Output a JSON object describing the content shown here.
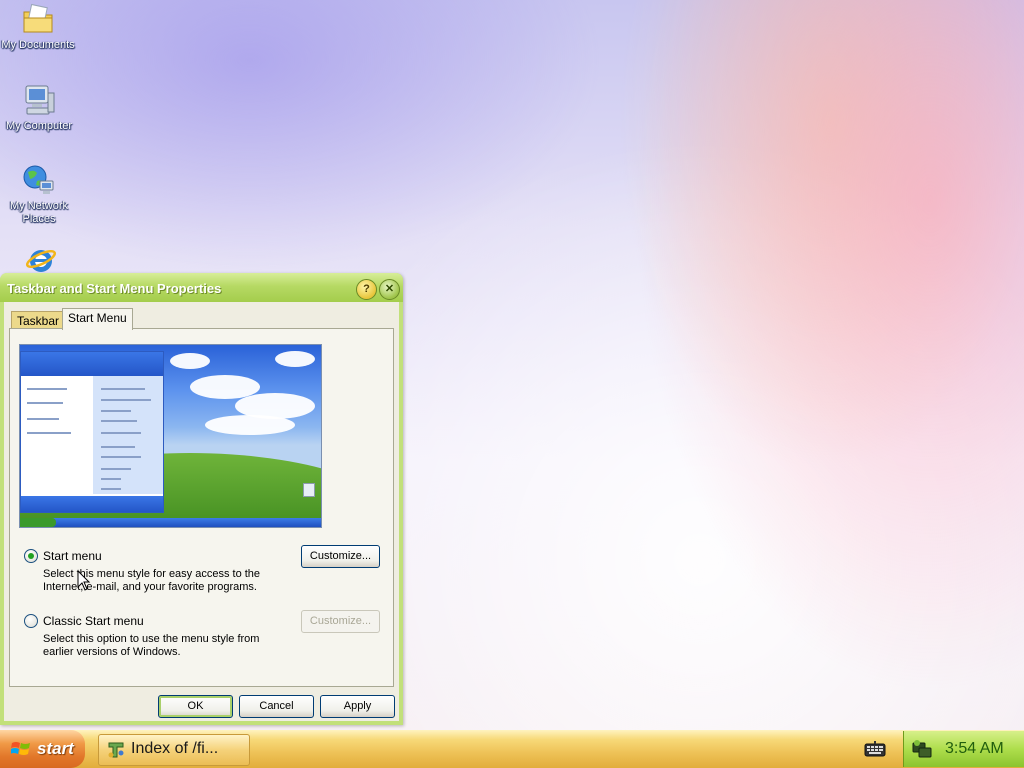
{
  "desktop": {
    "icons": [
      {
        "label": "My Documents",
        "icon": "folder-documents-icon"
      },
      {
        "label": "My Computer",
        "icon": "computer-icon"
      },
      {
        "label": "My Network Places",
        "icon": "network-icon"
      },
      {
        "label": "",
        "icon": "internet-explorer-icon"
      }
    ]
  },
  "dialog": {
    "title": "Taskbar and Start Menu Properties",
    "help_glyph": "?",
    "close_glyph": "✕",
    "tabs": [
      {
        "label": "Taskbar",
        "selected": false
      },
      {
        "label": "Start Menu",
        "selected": true
      }
    ],
    "options": {
      "start_menu": {
        "label": "Start menu",
        "selected": true,
        "description_line1": "Select this menu style for easy access to the",
        "description_line2": "Internet, e-mail, and your favorite programs.",
        "customize_label": "Customize...",
        "customize_enabled": true
      },
      "classic": {
        "label": "Classic Start menu",
        "selected": false,
        "description_line1": "Select this option to use the menu style from",
        "description_line2": "earlier versions of Windows.",
        "customize_label": "Customize...",
        "customize_enabled": false
      }
    },
    "buttons": {
      "ok": "OK",
      "cancel": "Cancel",
      "apply": "Apply"
    }
  },
  "taskbar": {
    "start_label": "start",
    "task_items": [
      {
        "label": "Index of /fi...",
        "icon": "ftp-tree-icon"
      }
    ],
    "keyboard_icon": "keyboard-icon",
    "tray_icon": "network-tray-icon",
    "clock": "3:54 AM"
  },
  "colors": {
    "taskbar_accent": "#eec257",
    "start_button": "#e2772a",
    "dialog_frame": "#b6d964",
    "tray": "#aede4c"
  }
}
